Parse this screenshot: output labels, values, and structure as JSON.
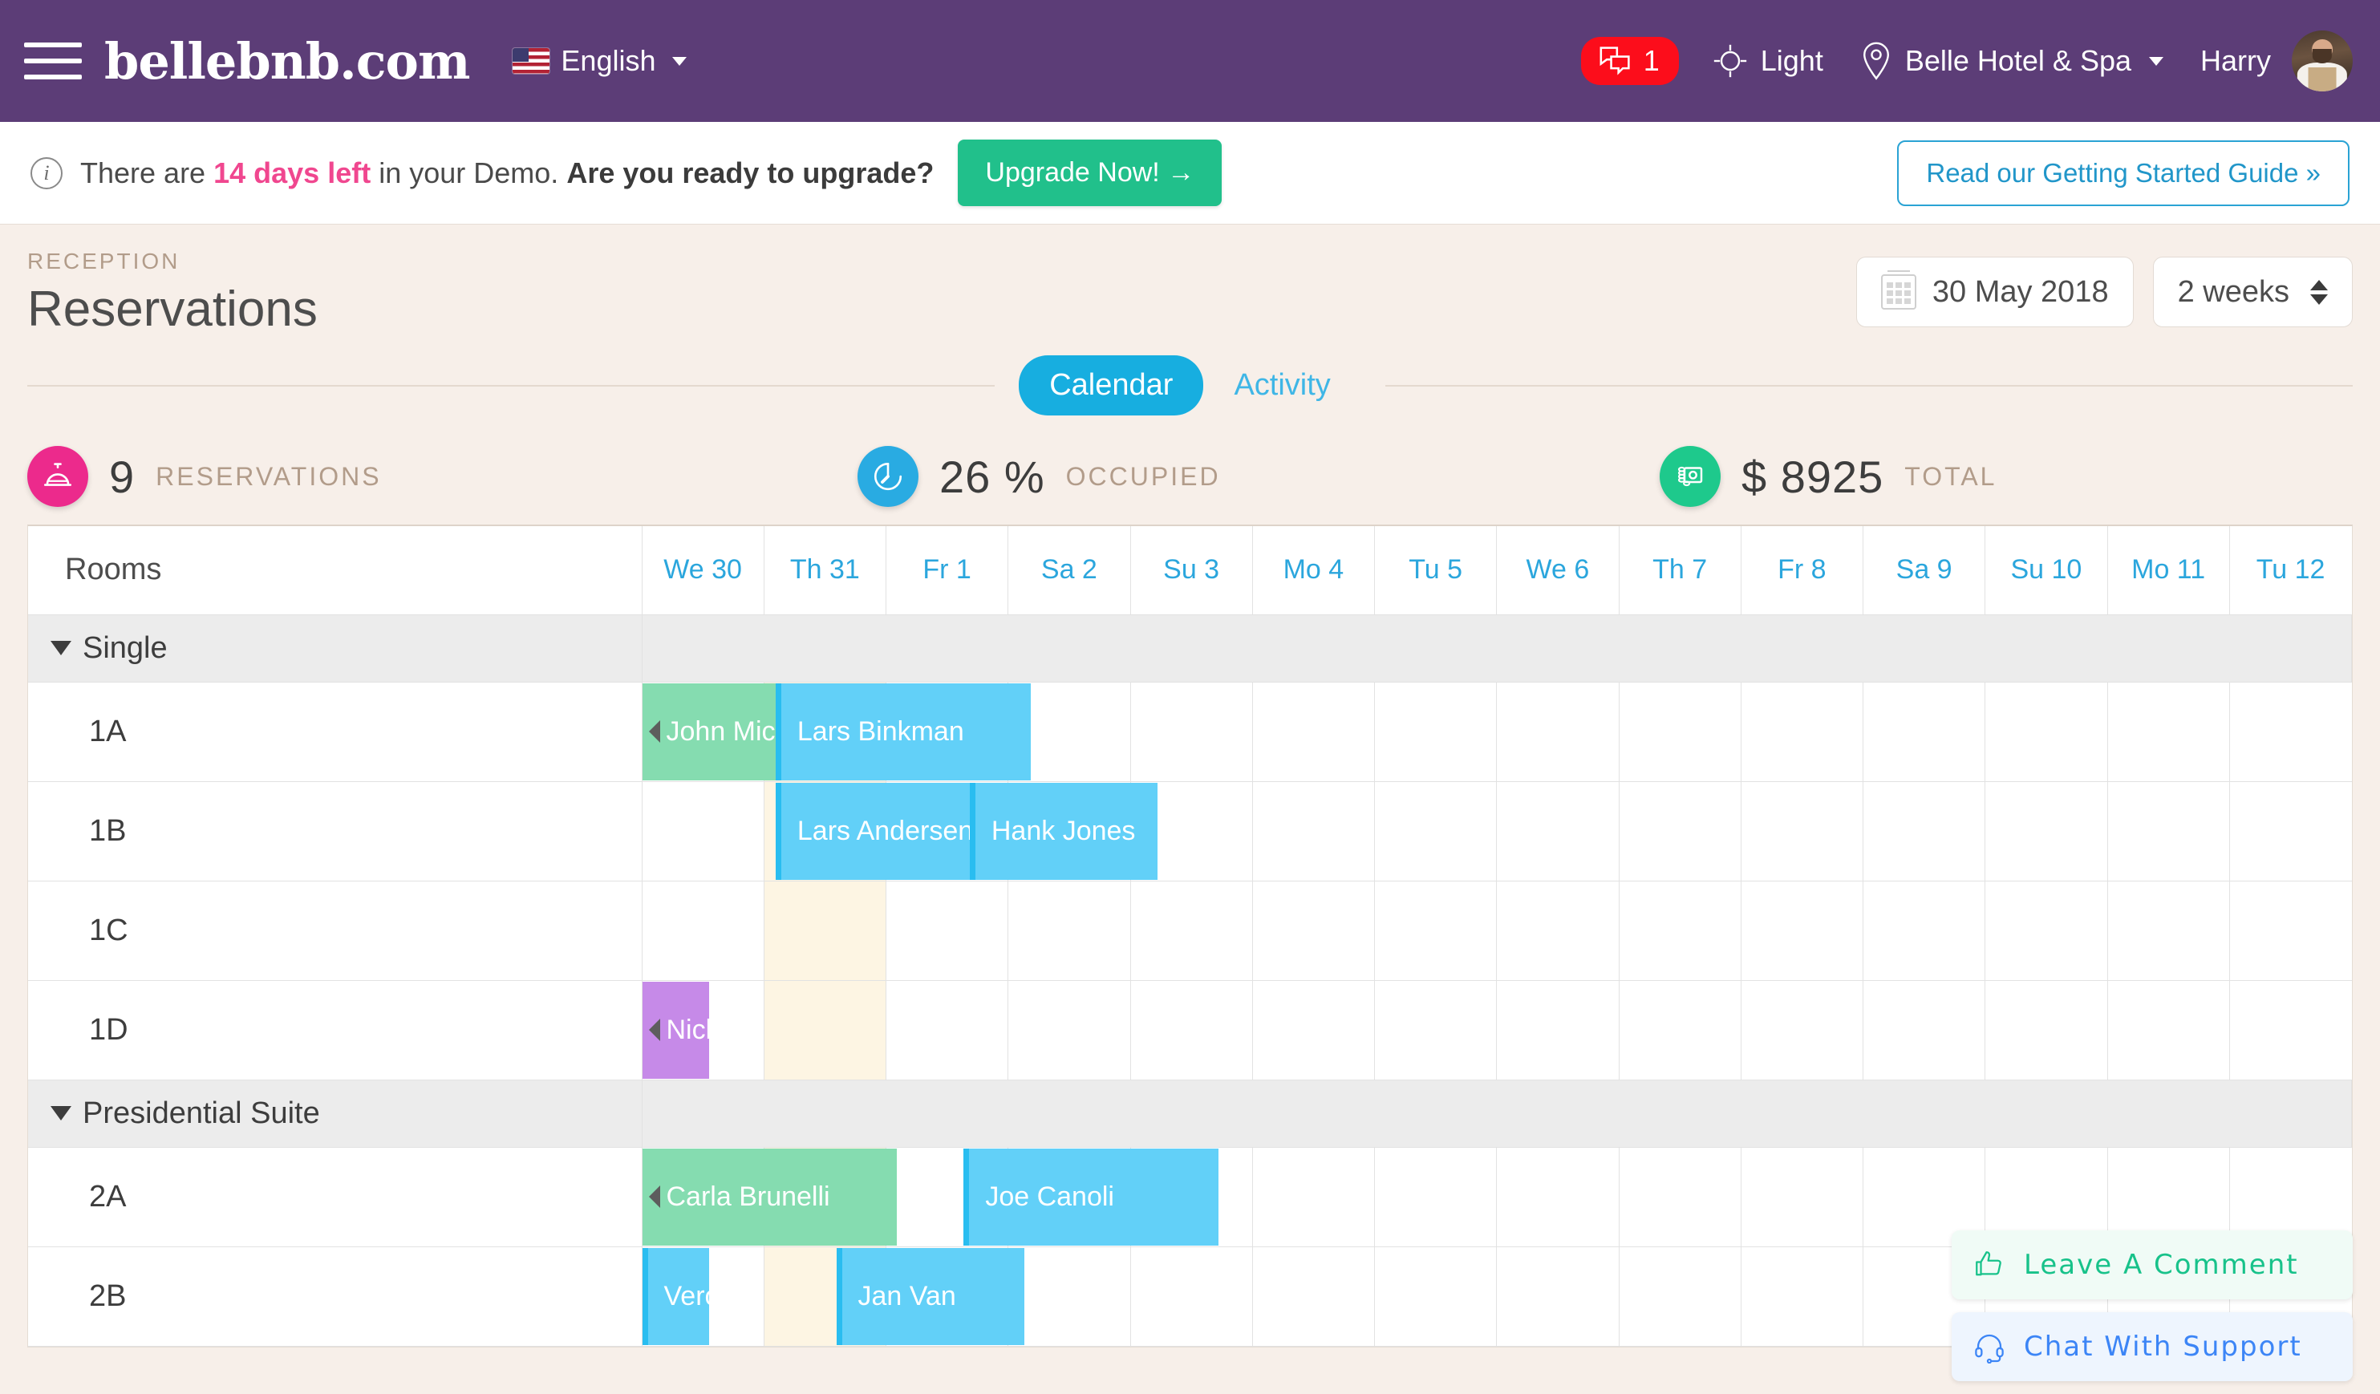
{
  "topnav": {
    "brand": "bellebnb.com",
    "menu_icon": "hamburger-icon",
    "language": "English",
    "messages_count": "1",
    "theme_label": "Light",
    "property": "Belle Hotel & Spa",
    "user": "Harry"
  },
  "banner": {
    "text_before": "There are",
    "days_left": "14 days left",
    "text_mid": "in your Demo.",
    "question": "Are you ready to upgrade?",
    "upgrade_label": "Upgrade Now! →",
    "guide_label": "Read our Getting Started Guide »"
  },
  "pagehead": {
    "kicker": "RECEPTION",
    "title": "Reservations",
    "date_value": "30 May 2018",
    "range_value": "2 weeks"
  },
  "tabs": [
    {
      "label": "Calendar",
      "active": true
    },
    {
      "label": "Activity",
      "active": false
    }
  ],
  "stats": [
    {
      "value": "9",
      "label": "RESERVATIONS",
      "color": "#ec2a8c",
      "icon": "service-bell-icon"
    },
    {
      "value": "26 %",
      "label": "OCCUPIED",
      "color": "#29abe2",
      "icon": "clock-icon"
    },
    {
      "value": "$ 8925",
      "label": "TOTAL",
      "color": "#1ec98c",
      "icon": "money-icon"
    }
  ],
  "calendar": {
    "rooms_header": "Rooms",
    "days": [
      {
        "label": "We 30",
        "weekend": false
      },
      {
        "label": "Th 31",
        "weekend": true
      },
      {
        "label": "Fr 1",
        "weekend": false
      },
      {
        "label": "Sa 2",
        "weekend": false
      },
      {
        "label": "Su 3",
        "weekend": false
      },
      {
        "label": "Mo 4",
        "weekend": false
      },
      {
        "label": "Tu 5",
        "weekend": false
      },
      {
        "label": "We 6",
        "weekend": false
      },
      {
        "label": "Th 7",
        "weekend": false
      },
      {
        "label": "Fr 8",
        "weekend": false
      },
      {
        "label": "Sa 9",
        "weekend": false
      },
      {
        "label": "Su 10",
        "weekend": false
      },
      {
        "label": "Mo 11",
        "weekend": false
      },
      {
        "label": "Tu 12",
        "weekend": false
      }
    ],
    "groups": [
      {
        "name": "Single",
        "rooms": [
          {
            "name": "1A",
            "reservations": [
              {
                "guest": "John Michael Ka",
                "color": "green",
                "start": 0,
                "span": 1.1,
                "continues_left": true
              },
              {
                "guest": "Lars Binkman",
                "color": "blue",
                "start": 1.1,
                "span": 2.1,
                "continues_left": false
              }
            ]
          },
          {
            "name": "1B",
            "reservations": [
              {
                "guest": "Lars Andersen",
                "color": "blue",
                "start": 1.1,
                "span": 1.6,
                "continues_left": false
              },
              {
                "guest": "Hank Jones",
                "color": "blue",
                "start": 2.7,
                "span": 1.55,
                "continues_left": false
              }
            ]
          },
          {
            "name": "1C",
            "reservations": []
          },
          {
            "name": "1D",
            "reservations": [
              {
                "guest": "Nick Pa",
                "color": "purple",
                "start": 0,
                "span": 0.55,
                "continues_left": true
              }
            ]
          }
        ]
      },
      {
        "name": "Presidential Suite",
        "rooms": [
          {
            "name": "2A",
            "reservations": [
              {
                "guest": "Carla Brunelli",
                "color": "green",
                "start": 0,
                "span": 2.1,
                "continues_left": true
              },
              {
                "guest": "Joe Canoli",
                "color": "blue",
                "start": 2.65,
                "span": 2.1,
                "continues_left": false
              }
            ]
          },
          {
            "name": "2B",
            "reservations": [
              {
                "guest": "Veronic",
                "color": "blue",
                "start": 0,
                "span": 0.55,
                "continues_left": false
              },
              {
                "guest": "Jan Van",
                "color": "blue",
                "start": 1.6,
                "span": 1.55,
                "continues_left": false
              }
            ]
          }
        ]
      }
    ]
  },
  "chat": {
    "comment_label": "Leave A Comment",
    "support_label": "Chat With Support"
  }
}
